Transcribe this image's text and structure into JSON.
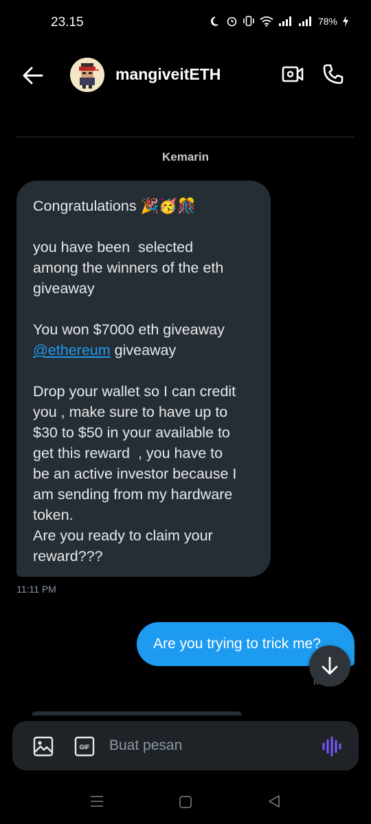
{
  "status_bar": {
    "time": "23.15",
    "battery": "78%"
  },
  "header": {
    "contact_name": "mangiveitETH",
    "back_icon": "arrow-left-icon",
    "video_icon": "video-call-icon",
    "call_icon": "phone-icon"
  },
  "conversation": {
    "date_label": "Kemarin",
    "received": {
      "line1": "Congratulations 🎉🥳🎊",
      "para2": "you have been  selected\namong the winners of the eth\ngiveaway",
      "para3_a": "You won $7000 eth giveaway\n",
      "mention": "@ethereum",
      "para3_b": " giveaway",
      "para4": "Drop your wallet so I can credit\nyou , make sure to have up to\n$30 to $50 in your available to\nget this reward  , you have to\nbe an active investor because I\nam sending from my hardware\ntoken.\nAre you ready to claim your\nreward???",
      "time": "11:11 PM"
    },
    "sent": {
      "text": "Are you trying to trick me?",
      "time_partial": "M"
    }
  },
  "composer": {
    "placeholder": "Buat pesan",
    "gif_label": "GIF"
  },
  "colors": {
    "accent": "#1d9bf0",
    "bubble_received": "#262e35",
    "voice": "#7856ff"
  }
}
